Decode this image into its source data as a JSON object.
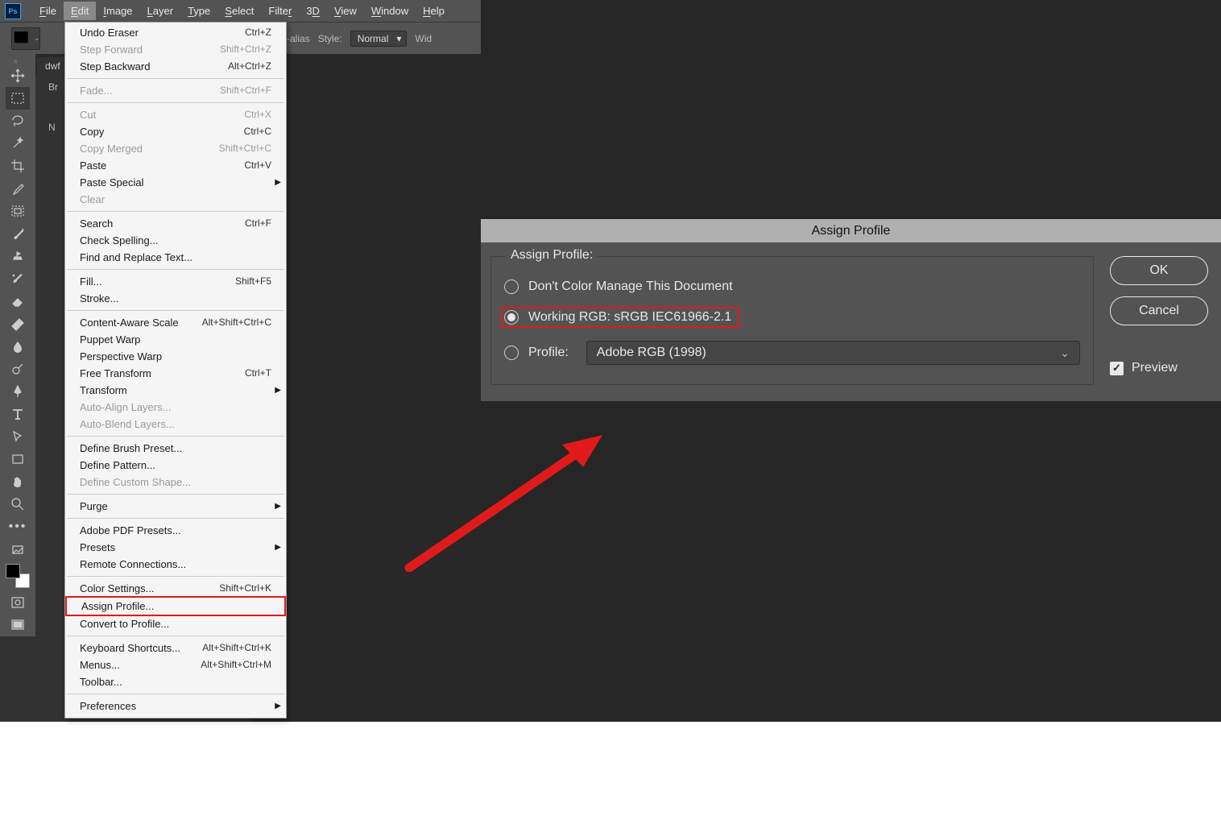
{
  "menubar": {
    "items": [
      "File",
      "Edit",
      "Image",
      "Layer",
      "Type",
      "Select",
      "Filter",
      "3D",
      "View",
      "Window",
      "Help"
    ],
    "active_index": 1
  },
  "optionbar": {
    "antialias_fragment": "ti-alias",
    "style_label": "Style:",
    "style_value": "Normal",
    "width_fragment": "Wid"
  },
  "document_tab": {
    "label": "dwf",
    "close_glyph": "×"
  },
  "side_panel": {
    "line1": "Br",
    "line2": "N"
  },
  "edit_menu": [
    {
      "label": "Undo Eraser",
      "shortcut": "Ctrl+Z",
      "enabled": true
    },
    {
      "label": "Step Forward",
      "shortcut": "Shift+Ctrl+Z",
      "enabled": false
    },
    {
      "label": "Step Backward",
      "shortcut": "Alt+Ctrl+Z",
      "enabled": true
    },
    {
      "sep": true
    },
    {
      "label": "Fade...",
      "shortcut": "Shift+Ctrl+F",
      "enabled": false
    },
    {
      "sep": true
    },
    {
      "label": "Cut",
      "shortcut": "Ctrl+X",
      "enabled": false
    },
    {
      "label": "Copy",
      "shortcut": "Ctrl+C",
      "enabled": true
    },
    {
      "label": "Copy Merged",
      "shortcut": "Shift+Ctrl+C",
      "enabled": false
    },
    {
      "label": "Paste",
      "shortcut": "Ctrl+V",
      "enabled": true
    },
    {
      "label": "Paste Special",
      "submenu": true,
      "enabled": true
    },
    {
      "label": "Clear",
      "enabled": false
    },
    {
      "sep": true
    },
    {
      "label": "Search",
      "shortcut": "Ctrl+F",
      "enabled": true
    },
    {
      "label": "Check Spelling...",
      "enabled": true
    },
    {
      "label": "Find and Replace Text...",
      "enabled": true
    },
    {
      "sep": true
    },
    {
      "label": "Fill...",
      "shortcut": "Shift+F5",
      "enabled": true
    },
    {
      "label": "Stroke...",
      "enabled": true
    },
    {
      "sep": true
    },
    {
      "label": "Content-Aware Scale",
      "shortcut": "Alt+Shift+Ctrl+C",
      "enabled": true
    },
    {
      "label": "Puppet Warp",
      "enabled": true
    },
    {
      "label": "Perspective Warp",
      "enabled": true
    },
    {
      "label": "Free Transform",
      "shortcut": "Ctrl+T",
      "enabled": true
    },
    {
      "label": "Transform",
      "submenu": true,
      "enabled": true
    },
    {
      "label": "Auto-Align Layers...",
      "enabled": false
    },
    {
      "label": "Auto-Blend Layers...",
      "enabled": false
    },
    {
      "sep": true
    },
    {
      "label": "Define Brush Preset...",
      "enabled": true
    },
    {
      "label": "Define Pattern...",
      "enabled": true
    },
    {
      "label": "Define Custom Shape...",
      "enabled": false
    },
    {
      "sep": true
    },
    {
      "label": "Purge",
      "submenu": true,
      "enabled": true
    },
    {
      "sep": true
    },
    {
      "label": "Adobe PDF Presets...",
      "enabled": true
    },
    {
      "label": "Presets",
      "submenu": true,
      "enabled": true
    },
    {
      "label": "Remote Connections...",
      "enabled": true
    },
    {
      "sep": true
    },
    {
      "label": "Color Settings...",
      "shortcut": "Shift+Ctrl+K",
      "enabled": true
    },
    {
      "label": "Assign Profile...",
      "enabled": true,
      "highlight": true
    },
    {
      "label": "Convert to Profile...",
      "enabled": true
    },
    {
      "sep": true
    },
    {
      "label": "Keyboard Shortcuts...",
      "shortcut": "Alt+Shift+Ctrl+K",
      "enabled": true
    },
    {
      "label": "Menus...",
      "shortcut": "Alt+Shift+Ctrl+M",
      "enabled": true
    },
    {
      "label": "Toolbar...",
      "enabled": true
    },
    {
      "sep": true
    },
    {
      "label": "Preferences",
      "submenu": true,
      "enabled": true
    }
  ],
  "tools": [
    "move",
    "rect-marquee",
    "lasso",
    "magic-wand",
    "crop",
    "eyedropper",
    "frame",
    "brush",
    "clone-stamp",
    "history-brush",
    "eraser",
    "paint-bucket",
    "blur",
    "dodge",
    "pen",
    "type",
    "path-select",
    "rectangle",
    "hand",
    "zoom",
    "more"
  ],
  "dialog": {
    "title": "Assign Profile",
    "legend": "Assign Profile:",
    "option_dont": "Don't Color Manage This Document",
    "option_working": "Working RGB:  sRGB IEC61966-2.1",
    "option_profile_label": "Profile:",
    "profile_value": "Adobe RGB (1998)",
    "ok": "OK",
    "cancel": "Cancel",
    "preview": "Preview",
    "selected": "working"
  }
}
